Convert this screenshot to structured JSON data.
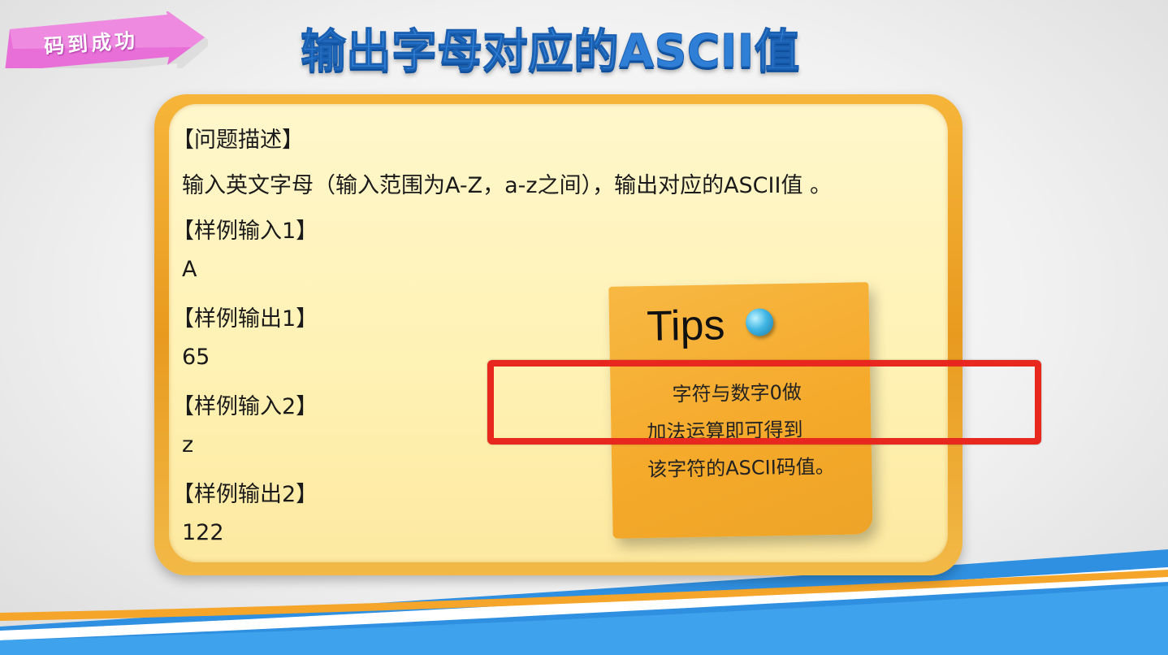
{
  "badge": {
    "text": "码到成功"
  },
  "title": "输出字母对应的ASCII值",
  "problem": {
    "heading": "【问题描述】",
    "description": "输入英文字母（输入范围为A-Z，a-z之间），输出对应的ASCII值 。",
    "samples": [
      {
        "label": "【样例输入1】",
        "value": "A"
      },
      {
        "label": "【样例输出1】",
        "value": "65"
      },
      {
        "label": "【样例输入2】",
        "value": "z"
      },
      {
        "label": "【样例输出2】",
        "value": "122"
      }
    ]
  },
  "tips": {
    "title": "Tips",
    "lines": [
      "字符与数字0做",
      "加法运算即可得到",
      "该字符的ASCII码值。"
    ]
  },
  "colors": {
    "title": "#2f7fd6",
    "badge": "#e86fd8",
    "card_border": "#f0a82c",
    "card_fill": "#fff4c0",
    "note": "#f6ad30",
    "highlight": "#e8281e"
  }
}
